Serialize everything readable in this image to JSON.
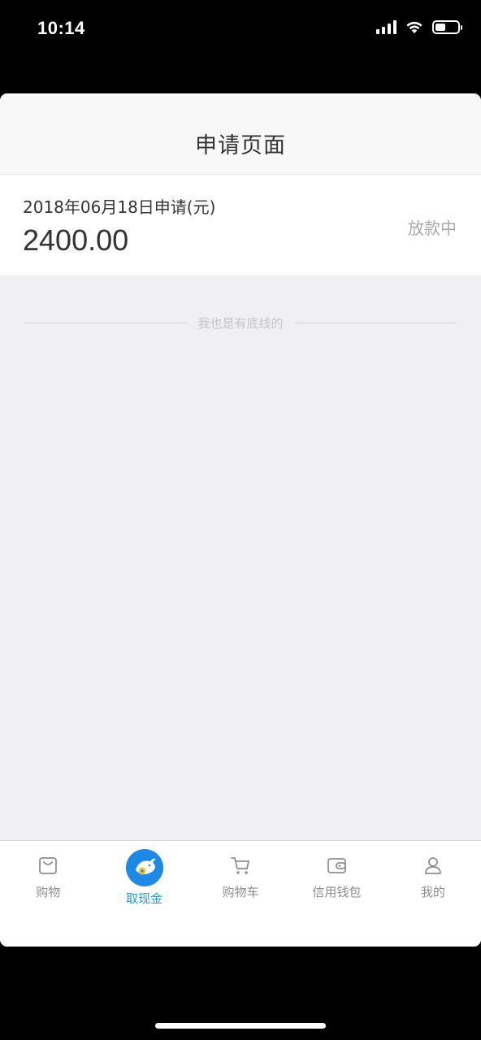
{
  "status_bar": {
    "time": "10:14",
    "battery_level": 0.45
  },
  "header": {
    "title": "申请页面"
  },
  "record": {
    "date_label": "2018年06月18日申请(元)",
    "amount": "2400.00",
    "status": "放款中"
  },
  "footer_note": "我也是有底线的",
  "tabs": [
    {
      "label": "购物",
      "icon": "shopping-bag-icon",
      "active": false
    },
    {
      "label": "取现金",
      "icon": "fish-coin-icon",
      "active": true
    },
    {
      "label": "购物车",
      "icon": "cart-icon",
      "active": false
    },
    {
      "label": "信用钱包",
      "icon": "wallet-icon",
      "active": false
    },
    {
      "label": "我的",
      "icon": "user-icon",
      "active": false
    }
  ],
  "colors": {
    "accent": "#1a9ee8",
    "background": "#efeff4",
    "muted": "#a8a8a8"
  }
}
